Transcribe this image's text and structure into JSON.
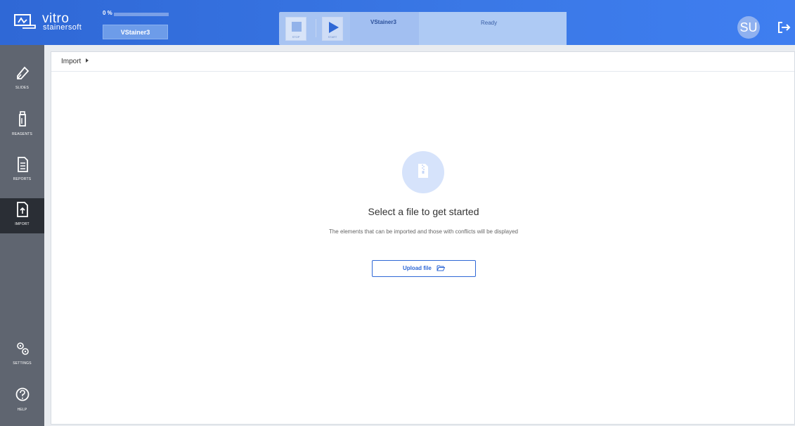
{
  "header": {
    "logo_brand": "vitro",
    "logo_sub": "stainersoft",
    "progress_label": "0 %",
    "progress_value": 0.0,
    "device_selector": "VStainer3",
    "controls": {
      "stop_label": "STOP",
      "start_label": "START"
    },
    "device_name": "VStainer3",
    "device_status": "Ready",
    "avatar_initials": "SU",
    "accent_color": "#2f68d6"
  },
  "sidebar": {
    "items": [
      {
        "label": "SLIDES",
        "icon": "eraser-icon"
      },
      {
        "label": "REAGENTS",
        "icon": "bottle-icon"
      },
      {
        "label": "REPORTS",
        "icon": "report-icon"
      },
      {
        "label": "IMPORT",
        "icon": "file-upload-icon",
        "active": true
      },
      {
        "label": "SETTINGS",
        "icon": "gears-icon"
      },
      {
        "label": "HELP",
        "icon": "help-icon"
      }
    ]
  },
  "main": {
    "breadcrumb": "Import",
    "empty_title": "Select a file to get started",
    "empty_subtitle": "The elements that can be imported and those with conflicts will be displayed",
    "upload_button": "Upload file"
  }
}
